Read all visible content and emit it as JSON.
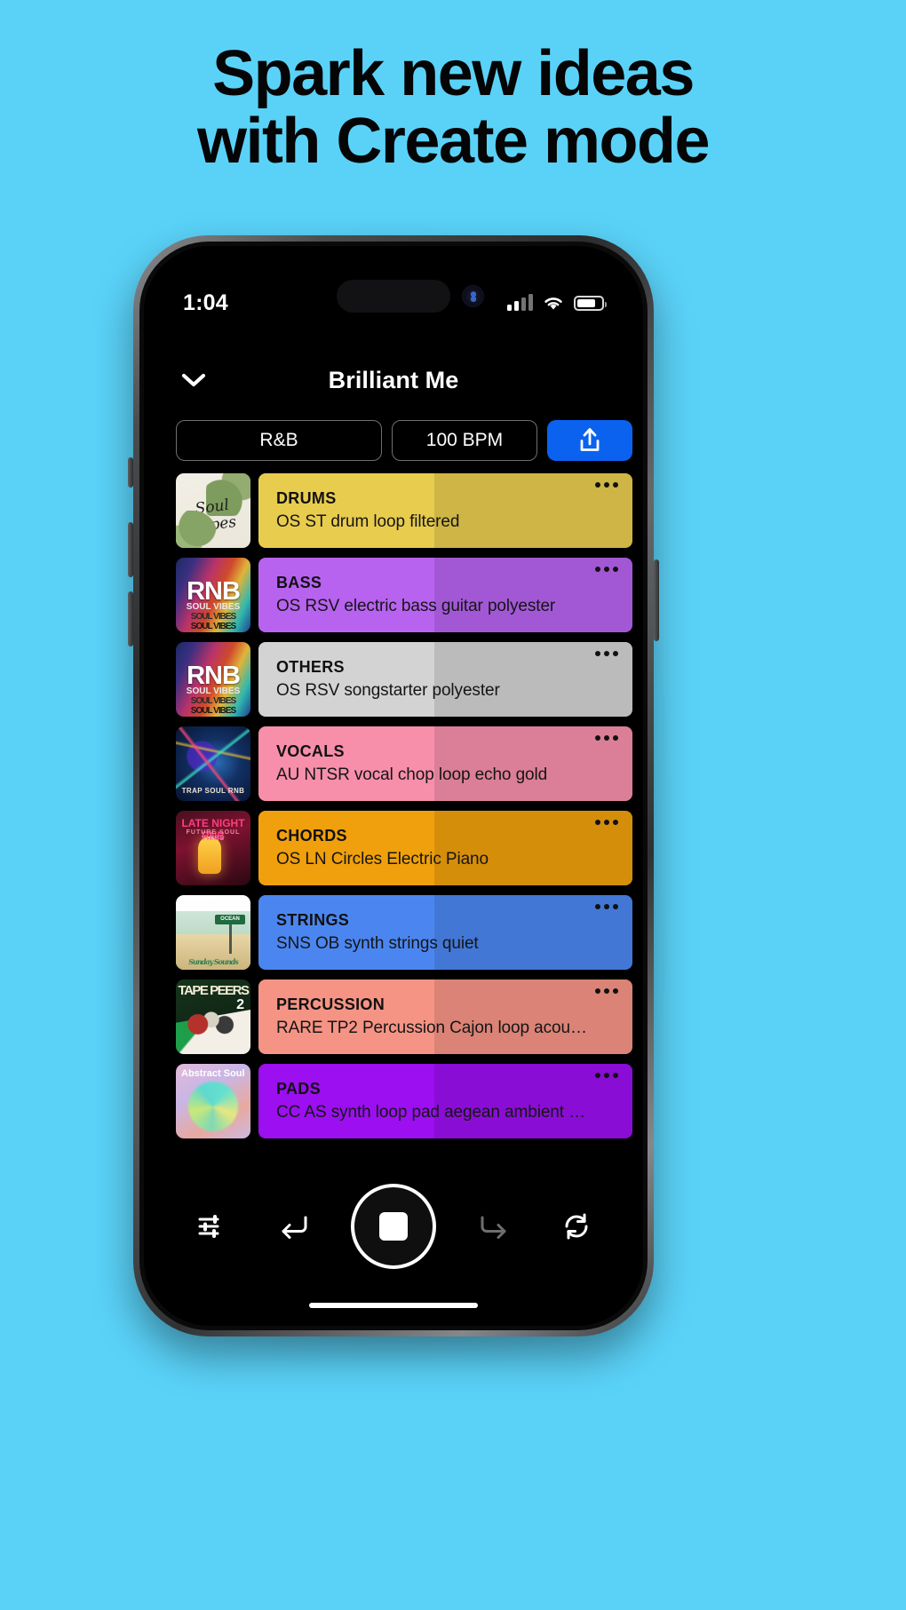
{
  "promo": {
    "headline_line1": "Spark new ideas",
    "headline_line2": "with Create mode",
    "background_color": "#5ad2f8",
    "text_color": "#050505"
  },
  "status_bar": {
    "time": "1:04",
    "signal_icon": "cellular-bars-icon",
    "wifi_icon": "wifi-icon",
    "battery_icon": "battery-icon",
    "battery_level": "78"
  },
  "header": {
    "collapse_icon": "chevron-down-icon",
    "title": "Brilliant Me"
  },
  "controls": {
    "key": "R&B",
    "bpm": "100 BPM",
    "share_icon": "share-icon",
    "share_color": "#0a62ef"
  },
  "tracks": [
    {
      "name": "DRUMS",
      "description": "OS ST drum loop filtered",
      "color": "#e8cc4e",
      "art": "a-soultapes",
      "art_title": "Soul Tapes",
      "art_sub": "",
      "menu_icon": "more-options-icon"
    },
    {
      "name": "BASS",
      "description": "OS RSV electric bass guitar polyester",
      "color": "#b763f0",
      "art": "a-rnb",
      "art_title": "RNB",
      "art_sub": "SOUL VIBES",
      "menu_icon": "more-options-icon"
    },
    {
      "name": "OTHERS",
      "description": "OS RSV songstarter polyester",
      "color": "#d3d3d3",
      "art": "a-rnb",
      "art_title": "RNB",
      "art_sub": "SOUL VIBES",
      "menu_icon": "more-options-icon"
    },
    {
      "name": "VOCALS",
      "description": "AU NTSR vocal chop loop echo gold",
      "color": "#f78fab",
      "art": "a-trap",
      "art_title": "",
      "art_sub": "TRAP SOUL RNB",
      "menu_icon": "more-options-icon"
    },
    {
      "name": "CHORDS",
      "description": "OS LN Circles Electric Piano",
      "color": "#f0a00c",
      "art": "a-latenight",
      "art_title": "LATE NIGHT RNB",
      "art_sub": "FUTURE SOUL VIBES",
      "menu_icon": "more-options-icon"
    },
    {
      "name": "STRINGS",
      "description": "SNS OB synth strings quiet",
      "color": "#4b86f0",
      "art": "a-ocean",
      "art_title": "OCEAN",
      "art_sub": "Sunday Sounds",
      "menu_icon": "more-options-icon"
    },
    {
      "name": "PERCUSSION",
      "description": "RARE TP2 Percussion Cajon loop acou…",
      "color": "#f59485",
      "art": "a-tape",
      "art_title": "TAPE PEERS",
      "art_sub": "2",
      "menu_icon": "more-options-icon"
    },
    {
      "name": "PADS",
      "description": "CC AS synth loop pad aegean ambient …",
      "color": "#9b0ff0",
      "art": "a-abstract",
      "art_title": "Abstract Soul",
      "art_sub": "",
      "menu_icon": "more-options-icon"
    }
  ],
  "toolbar": {
    "mixer_icon": "mixer-sliders-icon",
    "undo_icon": "undo-arrow-icon",
    "stop_icon": "stop-button-icon",
    "redo_icon": "redo-arrow-icon",
    "regenerate_icon": "refresh-icon"
  }
}
